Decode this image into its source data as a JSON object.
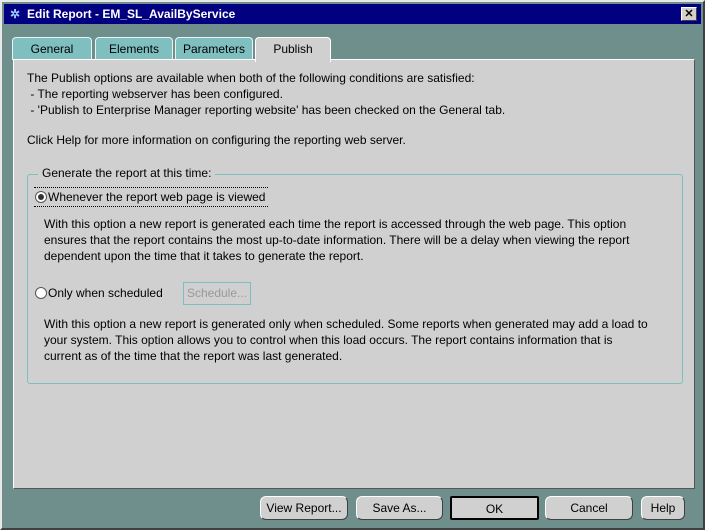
{
  "window": {
    "title": "Edit Report - EM_SL_AvailByService",
    "close": "✕"
  },
  "tabs": [
    {
      "label": "General"
    },
    {
      "label": "Elements"
    },
    {
      "label": "Parameters"
    },
    {
      "label": "Publish"
    }
  ],
  "intro": {
    "line1": "The Publish options are available when both of the following conditions are satisfied:",
    "line2": " - The reporting webserver has been configured.",
    "line3": " - 'Publish to Enterprise Manager reporting website' has been checked on the General tab.",
    "help": "Click Help for more information on configuring the reporting web server."
  },
  "group": {
    "legend": "Generate the report at this time:",
    "option1": {
      "label": "Whenever the report web page is viewed",
      "selected": true,
      "desc": [
        "With this option a new report is generated each time the report is accessed through the web page.  This option",
        "ensures that the report contains the most up-to-date information.  There will be a delay when viewing the report",
        "dependent upon the time that it takes to generate the report."
      ]
    },
    "option2": {
      "label": "Only when scheduled",
      "selected": false,
      "schedule_button": "Schedule...",
      "desc": [
        "With this option a new report is generated only when scheduled.  Some reports when generated may add a load to",
        "your system. This option allows you to control when this load occurs.  The report contains information that is",
        "current as of the time that the report was last generated."
      ]
    }
  },
  "buttons": {
    "view": "View Report...",
    "save": "Save As...",
    "ok": "OK",
    "cancel": "Cancel",
    "help": "Help"
  }
}
